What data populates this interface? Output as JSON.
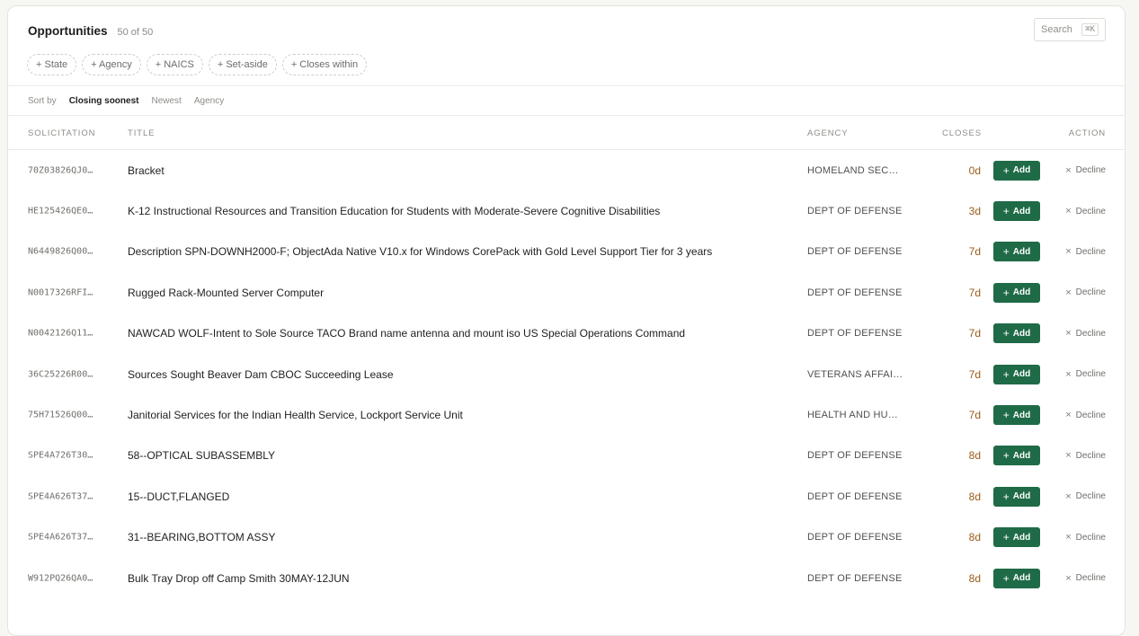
{
  "header": {
    "title": "Opportunities",
    "count": "50 of 50",
    "search_label": "Search",
    "search_shortcut": "⌘K"
  },
  "filters": [
    "+ State",
    "+ Agency",
    "+ NAICS",
    "+ Set-aside",
    "+ Closes within"
  ],
  "sort": {
    "label": "Sort by",
    "options": [
      "Closing soonest",
      "Newest",
      "Agency"
    ],
    "active": "Closing soonest"
  },
  "columns": {
    "solicitation": "SOLICITATION",
    "title": "TITLE",
    "agency": "AGENCY",
    "closes": "CLOSES",
    "action": "ACTION"
  },
  "actions": {
    "add": "Add",
    "add_glyph": "+",
    "decline": "Decline",
    "decline_glyph": "×"
  },
  "colors": {
    "accent": "#1f6b47",
    "closes": "#9a5b18"
  },
  "rows": [
    {
      "solicitation": "70Z03826QJ0…",
      "title": "Bracket",
      "agency": "HOMELAND SEC…",
      "closes": "0d"
    },
    {
      "solicitation": "HE125426QE0…",
      "title": "K-12 Instructional Resources and Transition Education for Students with Moderate-Severe Cognitive Disabilities",
      "agency": "DEPT OF DEFENSE",
      "closes": "3d"
    },
    {
      "solicitation": "N6449826Q00…",
      "title": "Description SPN-DOWNH2000-F; ObjectAda Native V10.x for Windows CorePack with Gold Level Support Tier for 3 years",
      "agency": "DEPT OF DEFENSE",
      "closes": "7d"
    },
    {
      "solicitation": "N0017326RFI…",
      "title": "Rugged Rack-Mounted Server Computer",
      "agency": "DEPT OF DEFENSE",
      "closes": "7d"
    },
    {
      "solicitation": "N0042126Q11…",
      "title": "NAWCAD WOLF-Intent to Sole Source TACO Brand name antenna and mount iso US Special Operations Command",
      "agency": "DEPT OF DEFENSE",
      "closes": "7d"
    },
    {
      "solicitation": "36C25226R00…",
      "title": "Sources Sought Beaver Dam CBOC Succeeding Lease",
      "agency": "VETERANS AFFAI…",
      "closes": "7d"
    },
    {
      "solicitation": "75H71526Q00…",
      "title": "Janitorial Services for the Indian Health Service, Lockport Service Unit",
      "agency": "HEALTH AND HU…",
      "closes": "7d"
    },
    {
      "solicitation": "SPE4A726T30…",
      "title": "58--OPTICAL SUBASSEMBLY",
      "agency": "DEPT OF DEFENSE",
      "closes": "8d"
    },
    {
      "solicitation": "SPE4A626T37…",
      "title": "15--DUCT,FLANGED",
      "agency": "DEPT OF DEFENSE",
      "closes": "8d"
    },
    {
      "solicitation": "SPE4A626T37…",
      "title": "31--BEARING,BOTTOM ASSY",
      "agency": "DEPT OF DEFENSE",
      "closes": "8d"
    },
    {
      "solicitation": "W912PQ26QA0…",
      "title": "Bulk Tray Drop off Camp Smith 30MAY-12JUN",
      "agency": "DEPT OF DEFENSE",
      "closes": "8d"
    }
  ]
}
